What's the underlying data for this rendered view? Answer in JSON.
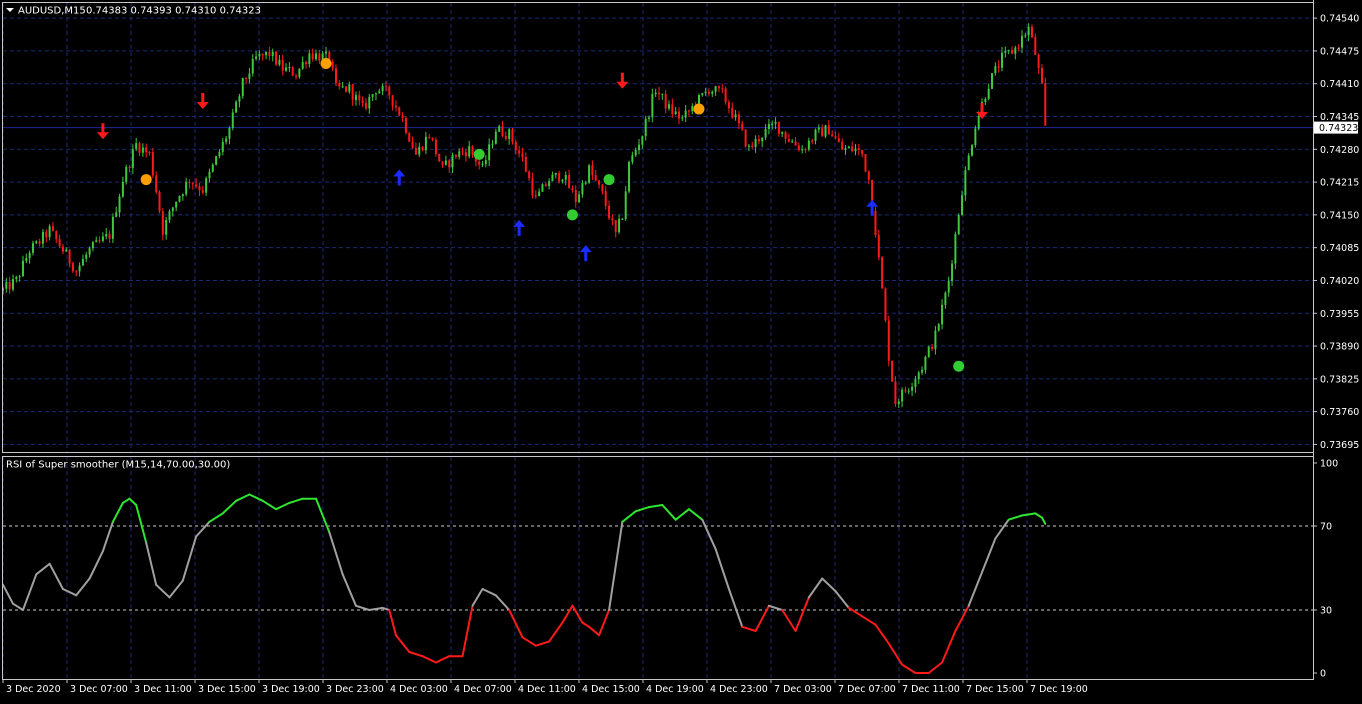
{
  "header": {
    "symbol": "AUDUSD,M15",
    "ohlc": "0.74383 0.74393 0.74310 0.74323"
  },
  "colors": {
    "bull": "#3ec93e",
    "bear": "#ff1a1a",
    "grid": "#1b2a73",
    "current_price_line": "#1b2a9a",
    "arrow_down": "#ff1a1a",
    "arrow_up": "#1a2cff",
    "dot_orange": "#ffa000",
    "dot_green": "#32cd32",
    "rsi_up": "#2ee62e",
    "rsi_down": "#ff1a1a",
    "rsi_neutral": "#a0a0a0"
  },
  "price_axis": {
    "ticks": [
      "0.74540",
      "0.74475",
      "0.74410",
      "0.74345",
      "0.74280",
      "0.74215",
      "0.74150",
      "0.74085",
      "0.74020",
      "0.73955",
      "0.73890",
      "0.73825",
      "0.73760",
      "0.73695"
    ],
    "current_label": "0.74323"
  },
  "time_axis": {
    "labels": [
      "3 Dec 2020",
      "3 Dec 07:00",
      "3 Dec 11:00",
      "3 Dec 15:00",
      "3 Dec 19:00",
      "3 Dec 23:00",
      "4 Dec 03:00",
      "4 Dec 07:00",
      "4 Dec 11:00",
      "4 Dec 15:00",
      "4 Dec 19:00",
      "4 Dec 23:00",
      "7 Dec 03:00",
      "7 Dec 07:00",
      "7 Dec 11:00",
      "7 Dec 15:00",
      "7 Dec 19:00"
    ]
  },
  "indicator": {
    "title": "RSI of Super smoother (M15,14,70.00,30.00)",
    "axis_labels": [
      "100",
      "70",
      "30",
      "0"
    ]
  },
  "chart_data": [
    {
      "type": "candlestick",
      "title": "AUDUSD,M15",
      "ylim": [
        0.7368,
        0.7457
      ],
      "current_price": 0.74323,
      "price_path": [
        [
          0,
          0.74
        ],
        [
          4,
          0.7402
        ],
        [
          8,
          0.7408
        ],
        [
          10,
          0.7409
        ],
        [
          14,
          0.7412
        ],
        [
          18,
          0.7408
        ],
        [
          22,
          0.7404
        ],
        [
          26,
          0.7408
        ],
        [
          32,
          0.7411
        ],
        [
          36,
          0.7422
        ],
        [
          40,
          0.7429
        ],
        [
          44,
          0.7427
        ],
        [
          46,
          0.742
        ],
        [
          48,
          0.7412
        ],
        [
          52,
          0.7418
        ],
        [
          56,
          0.7422
        ],
        [
          60,
          0.742
        ],
        [
          64,
          0.7426
        ],
        [
          68,
          0.7432
        ],
        [
          72,
          0.7441
        ],
        [
          76,
          0.7446
        ],
        [
          80,
          0.7447
        ],
        [
          84,
          0.7444
        ],
        [
          88,
          0.7443
        ],
        [
          92,
          0.7447
        ],
        [
          98,
          0.7446
        ],
        [
          100,
          0.744
        ],
        [
          104,
          0.744
        ],
        [
          108,
          0.7436
        ],
        [
          112,
          0.744
        ],
        [
          116,
          0.7439
        ],
        [
          120,
          0.7434
        ],
        [
          124,
          0.7427
        ],
        [
          128,
          0.7431
        ],
        [
          132,
          0.7424
        ],
        [
          136,
          0.7427
        ],
        [
          140,
          0.7428
        ],
        [
          144,
          0.7424
        ],
        [
          148,
          0.7432
        ],
        [
          152,
          0.7431
        ],
        [
          156,
          0.7426
        ],
        [
          160,
          0.7418
        ],
        [
          164,
          0.7422
        ],
        [
          168,
          0.7423
        ],
        [
          172,
          0.7418
        ],
        [
          176,
          0.7424
        ],
        [
          180,
          0.7419
        ],
        [
          184,
          0.7411
        ],
        [
          186,
          0.7415
        ],
        [
          188,
          0.7425
        ],
        [
          192,
          0.7431
        ],
        [
          196,
          0.744
        ],
        [
          200,
          0.7436
        ],
        [
          204,
          0.7434
        ],
        [
          208,
          0.7437
        ],
        [
          212,
          0.744
        ],
        [
          216,
          0.7439
        ],
        [
          220,
          0.7434
        ],
        [
          224,
          0.7428
        ],
        [
          228,
          0.7431
        ],
        [
          232,
          0.7433
        ],
        [
          236,
          0.743
        ],
        [
          240,
          0.7428
        ],
        [
          244,
          0.7431
        ],
        [
          248,
          0.7432
        ],
        [
          252,
          0.7428
        ],
        [
          256,
          0.7428
        ],
        [
          258,
          0.7427
        ],
        [
          260,
          0.7422
        ],
        [
          262,
          0.7412
        ],
        [
          264,
          0.74
        ],
        [
          266,
          0.7387
        ],
        [
          268,
          0.7378
        ],
        [
          272,
          0.7381
        ],
        [
          276,
          0.7385
        ],
        [
          280,
          0.7391
        ],
        [
          284,
          0.7402
        ],
        [
          288,
          0.742
        ],
        [
          292,
          0.7433
        ],
        [
          296,
          0.7441
        ],
        [
          300,
          0.7446
        ],
        [
          304,
          0.7448
        ],
        [
          308,
          0.7452
        ],
        [
          310,
          0.7447
        ],
        [
          312,
          0.744
        ],
        [
          313,
          0.7432
        ]
      ],
      "signals": [
        {
          "type": "arrow-down",
          "bar": 30,
          "price": 0.743
        },
        {
          "type": "arrow-down",
          "bar": 60,
          "price": 0.7436
        },
        {
          "type": "arrow-down",
          "bar": 186,
          "price": 0.744
        },
        {
          "type": "arrow-down",
          "bar": 294,
          "price": 0.7434
        },
        {
          "type": "arrow-up",
          "bar": 119,
          "price": 0.7424
        },
        {
          "type": "arrow-up",
          "bar": 155,
          "price": 0.7414
        },
        {
          "type": "arrow-up",
          "bar": 175,
          "price": 0.7409
        },
        {
          "type": "arrow-up",
          "bar": 261,
          "price": 0.7418
        },
        {
          "type": "dot-orange",
          "bar": 43,
          "price": 0.7422
        },
        {
          "type": "dot-orange",
          "bar": 97,
          "price": 0.7445
        },
        {
          "type": "dot-orange",
          "bar": 209,
          "price": 0.7436
        },
        {
          "type": "dot-green",
          "bar": 143,
          "price": 0.7427
        },
        {
          "type": "dot-green",
          "bar": 171,
          "price": 0.7415
        },
        {
          "type": "dot-green",
          "bar": 182,
          "price": 0.7422
        },
        {
          "type": "dot-green",
          "bar": 287,
          "price": 0.7385
        }
      ]
    },
    {
      "type": "line",
      "title": "RSI of Super smoother (M15,14,70.00,30.00)",
      "ylim": [
        0,
        100
      ],
      "levels": [
        70,
        30
      ],
      "points": [
        [
          0,
          42
        ],
        [
          3,
          33
        ],
        [
          6,
          30
        ],
        [
          10,
          47
        ],
        [
          14,
          52
        ],
        [
          18,
          40
        ],
        [
          22,
          37
        ],
        [
          26,
          45
        ],
        [
          30,
          58
        ],
        [
          33,
          72
        ],
        [
          36,
          81
        ],
        [
          38,
          83
        ],
        [
          40,
          80
        ],
        [
          43,
          62
        ],
        [
          46,
          42
        ],
        [
          50,
          36
        ],
        [
          54,
          44
        ],
        [
          58,
          65
        ],
        [
          62,
          72
        ],
        [
          66,
          76
        ],
        [
          70,
          82
        ],
        [
          74,
          85
        ],
        [
          78,
          82
        ],
        [
          82,
          78
        ],
        [
          86,
          81
        ],
        [
          90,
          83
        ],
        [
          94,
          83
        ],
        [
          98,
          67
        ],
        [
          102,
          47
        ],
        [
          106,
          32
        ],
        [
          110,
          30
        ],
        [
          114,
          31
        ],
        [
          116,
          30
        ],
        [
          118,
          18
        ],
        [
          122,
          10
        ],
        [
          126,
          8
        ],
        [
          130,
          5
        ],
        [
          134,
          8
        ],
        [
          138,
          8
        ],
        [
          141,
          32
        ],
        [
          144,
          40
        ],
        [
          148,
          37
        ],
        [
          152,
          30
        ],
        [
          156,
          17
        ],
        [
          160,
          13
        ],
        [
          164,
          15
        ],
        [
          168,
          24
        ],
        [
          171,
          32
        ],
        [
          174,
          24
        ],
        [
          176,
          22
        ],
        [
          179,
          18
        ],
        [
          182,
          30
        ],
        [
          186,
          72
        ],
        [
          190,
          77
        ],
        [
          194,
          79
        ],
        [
          198,
          80
        ],
        [
          202,
          73
        ],
        [
          206,
          78
        ],
        [
          210,
          73
        ],
        [
          214,
          59
        ],
        [
          218,
          40
        ],
        [
          222,
          22
        ],
        [
          226,
          20
        ],
        [
          230,
          32
        ],
        [
          234,
          30
        ],
        [
          238,
          20
        ],
        [
          242,
          36
        ],
        [
          246,
          45
        ],
        [
          250,
          39
        ],
        [
          254,
          31
        ],
        [
          258,
          27
        ],
        [
          262,
          23
        ],
        [
          266,
          14
        ],
        [
          270,
          4
        ],
        [
          274,
          0
        ],
        [
          278,
          0
        ],
        [
          282,
          5
        ],
        [
          286,
          20
        ],
        [
          290,
          32
        ],
        [
          294,
          48
        ],
        [
          298,
          64
        ],
        [
          302,
          73
        ],
        [
          306,
          75
        ],
        [
          310,
          76
        ],
        [
          312,
          74
        ],
        [
          313,
          71
        ]
      ]
    }
  ]
}
